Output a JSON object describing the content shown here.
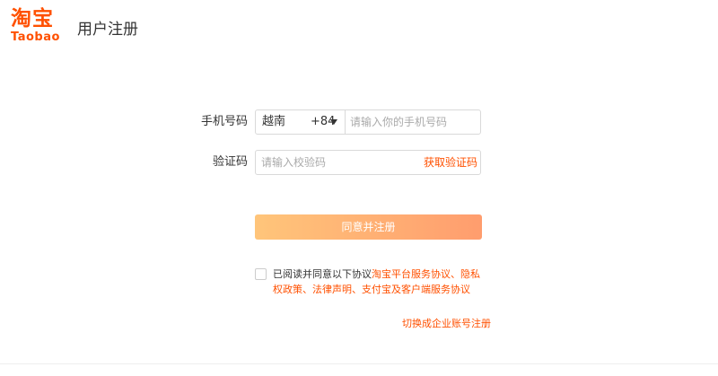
{
  "header": {
    "logo_cn": "淘宝",
    "logo_en": "Taobao",
    "title": "用户注册"
  },
  "form": {
    "phone_label": "手机号码",
    "country": "越南",
    "country_code": "+84",
    "phone_placeholder": "请输入你的手机号码",
    "code_label": "验证码",
    "code_placeholder": "请输入校验码",
    "get_code": "获取验证码",
    "submit": "同意并注册"
  },
  "agreement": {
    "prefix": "已阅读并同意以下协议",
    "link1": "淘宝平台服务协议",
    "sep1": "、",
    "link2": "隐私权政策",
    "sep2": "、",
    "link3": "法律声明",
    "sep3": "、",
    "link4": "支付宝及客户端服务协议"
  },
  "switch_link": "切换成企业账号注册",
  "colors": {
    "brand": "#ff5000",
    "button_start": "#ffc57a",
    "button_end": "#ff9d6e"
  }
}
